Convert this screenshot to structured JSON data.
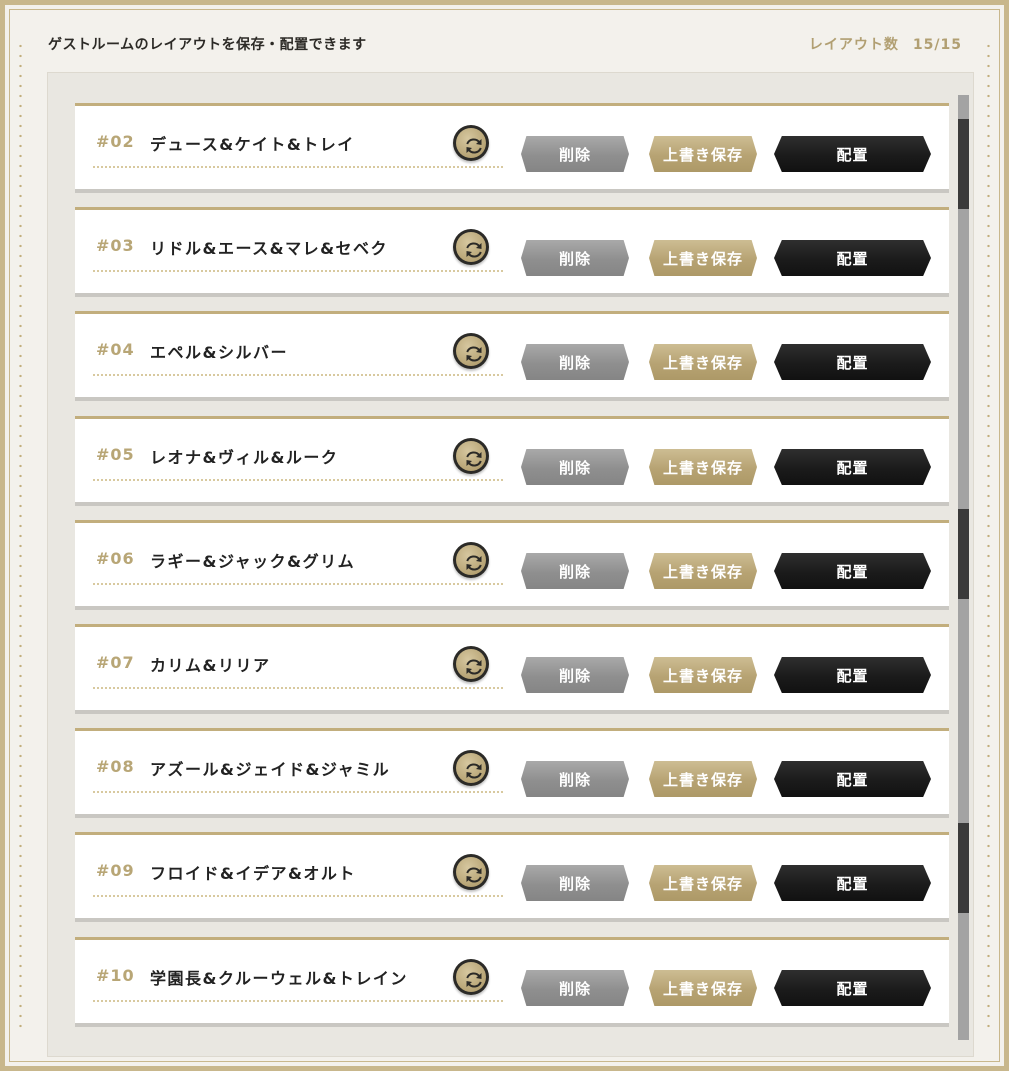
{
  "header": {
    "title": "ゲストルームのレイアウトを保存・配置できます",
    "count_label": "レイアウト数",
    "count_value": "15/15"
  },
  "buttons": {
    "delete": "削除",
    "overwrite": "上書き保存",
    "place": "配置"
  },
  "icons": {
    "rename": "refresh-icon"
  },
  "layouts": [
    {
      "number": "#02",
      "name": "デュース&ケイト&トレイ"
    },
    {
      "number": "#03",
      "name": "リドル&エース&マレ&セベク"
    },
    {
      "number": "#04",
      "name": "エペル&シルバー"
    },
    {
      "number": "#05",
      "name": "レオナ&ヴィル&ルーク"
    },
    {
      "number": "#06",
      "name": "ラギー&ジャック&グリム"
    },
    {
      "number": "#07",
      "name": "カリム&リリア"
    },
    {
      "number": "#08",
      "name": "アズール&ジェイド&ジャミル"
    },
    {
      "number": "#09",
      "name": "フロイド&イデア&オルト"
    },
    {
      "number": "#10",
      "name": "学園長&クルーウェル&トレイン"
    }
  ],
  "colors": {
    "gold": "#c2ae7d",
    "delete_btn": "#969696",
    "overwrite_btn": "#b7a373",
    "place_btn": "#1b1b1b"
  }
}
